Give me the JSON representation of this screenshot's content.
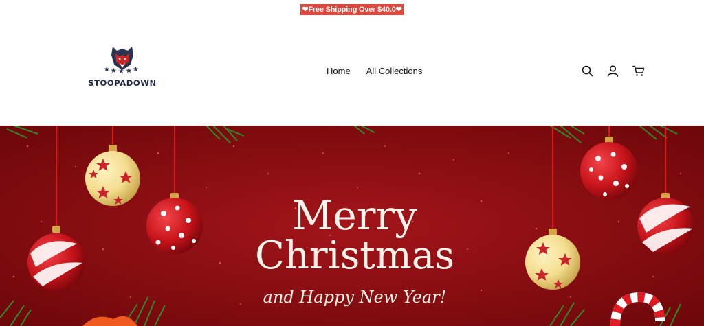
{
  "announcement": {
    "text": "❤Free Shipping Over $40.0❤"
  },
  "header": {
    "logo_text": "STOOPADOWN",
    "nav": [
      {
        "label": "Home"
      },
      {
        "label": "All Collections"
      }
    ],
    "icons": [
      "search-icon",
      "account-icon",
      "cart-icon"
    ]
  },
  "banner": {
    "headline_1": "Merry",
    "headline_2": "Christmas",
    "tagline": "and Happy New Year!",
    "colors": {
      "background": "#8a0c0e",
      "text": "#fbf2ea",
      "ornament_red": "#c8141b",
      "ornament_gold": "#f2dc8c"
    }
  }
}
